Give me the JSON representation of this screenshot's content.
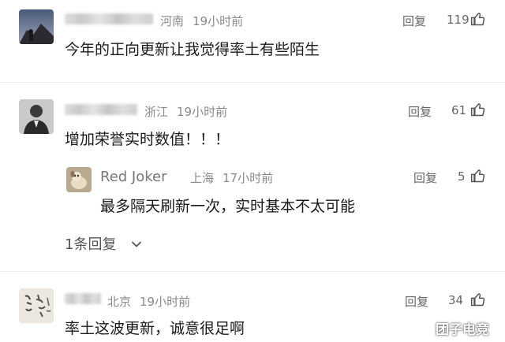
{
  "comments": [
    {
      "region": "河南",
      "time": "19小时前",
      "reply_label": "回复",
      "likes": "119",
      "text": "今年的正向更新让我觉得率土有些陌生"
    },
    {
      "region": "浙江",
      "time": "19小时前",
      "reply_label": "回复",
      "likes": "61",
      "text": "增加荣誉实时数值！！！",
      "sub_reply": {
        "author": "Red Joker",
        "region": "上海",
        "time": "17小时前",
        "reply_label": "回复",
        "likes": "5",
        "text": "最多隔天刷新一次，实时基本不太可能"
      },
      "more_replies": "1条回复"
    },
    {
      "region": "北京",
      "time": "19小时前",
      "reply_label": "回复",
      "likes": "34",
      "text": "率土这波更新，诚意很足啊"
    }
  ],
  "watermark": "团子电竞",
  "icons": {
    "like": "thumbs-up-icon",
    "expand": "chevron-down-icon"
  }
}
